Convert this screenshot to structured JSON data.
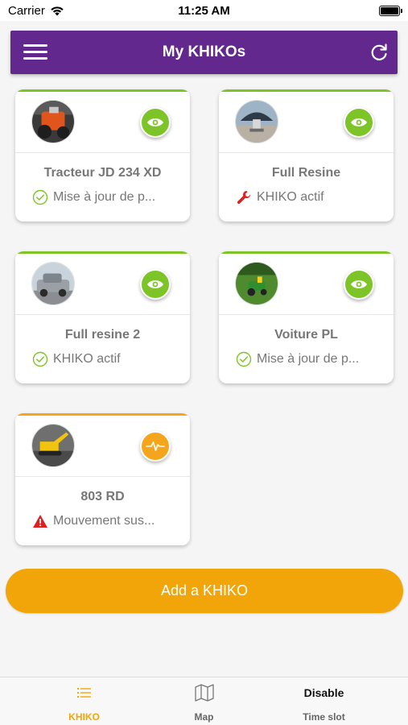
{
  "status_bar": {
    "carrier": "Carrier",
    "time": "11:25 AM"
  },
  "header": {
    "title": "My KHIKOs",
    "menu_icon": "hamburger-menu-icon",
    "refresh_icon": "refresh-icon",
    "background_color": "#63288e"
  },
  "khikos": [
    {
      "name": "Tracteur JD 234 XD",
      "status": "Mise à jour de p...",
      "status_icon": "check-circle-icon",
      "badge_icon": "eye-icon",
      "state": "green"
    },
    {
      "name": "Full Resine",
      "status": "KHIKO actif",
      "status_icon": "wrench-icon",
      "badge_icon": "eye-icon",
      "state": "green"
    },
    {
      "name": "Full resine 2",
      "status": "KHIKO actif",
      "status_icon": "check-circle-icon",
      "badge_icon": "eye-icon",
      "state": "green"
    },
    {
      "name": "Voiture PL",
      "status": "Mise à jour de p...",
      "status_icon": "check-circle-icon",
      "badge_icon": "eye-icon",
      "state": "green"
    },
    {
      "name": "803 RD",
      "status": "Mouvement sus...",
      "status_icon": "warning-icon",
      "badge_icon": "pulse-icon",
      "state": "orange"
    }
  ],
  "add_button": {
    "label": "Add a KHIKO",
    "color": "#f2a509"
  },
  "tabbar": {
    "tabs": [
      {
        "label": "KHIKO",
        "icon": "list-icon",
        "active": true
      },
      {
        "label": "Map",
        "icon": "map-icon",
        "active": false
      },
      {
        "label": "Time slot",
        "icon_text": "Disable",
        "active": false
      }
    ]
  },
  "colors": {
    "accent_green": "#7cc427",
    "accent_orange": "#f4a51c",
    "warning_red": "#e02020"
  }
}
